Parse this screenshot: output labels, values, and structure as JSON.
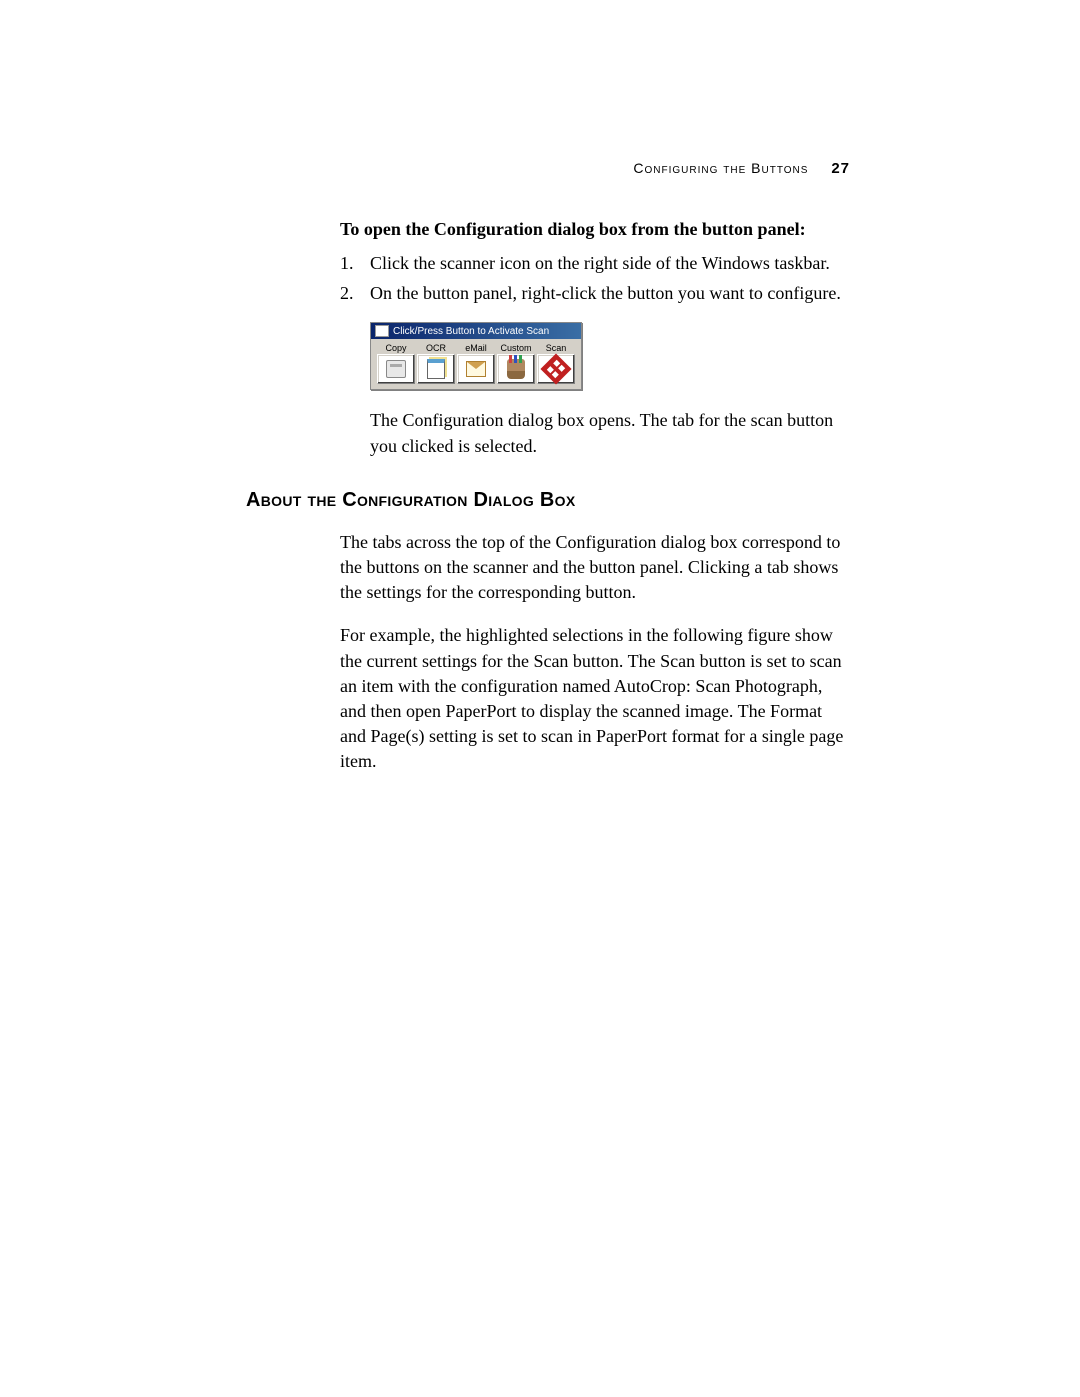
{
  "header": {
    "section": "Configuring the Buttons",
    "page_number": "27"
  },
  "intro_heading": "To open the Configuration dialog box from the button panel:",
  "steps": [
    "Click the scanner icon on the right side of the Windows taskbar.",
    "On the button panel, right-click the button you want to configure."
  ],
  "panel": {
    "title": "Click/Press Button to Activate Scan",
    "buttons": [
      {
        "label": "Copy",
        "icon": "icon-copy"
      },
      {
        "label": "OCR",
        "icon": "icon-ocr"
      },
      {
        "label": "eMail",
        "icon": "icon-email"
      },
      {
        "label": "Custom",
        "icon": "icon-custom"
      },
      {
        "label": "Scan",
        "icon": "icon-scan"
      }
    ]
  },
  "after_figure": "The Configuration dialog box opens. The tab for the scan button you clicked is selected.",
  "section_heading": "About the Configuration Dialog Box",
  "paragraphs": [
    "The tabs across the top of the Configuration dialog box correspond to the buttons on the scanner and the button panel. Clicking a tab shows the settings for the corresponding button.",
    "For example, the highlighted selections in the following figure show the current settings for the Scan button. The Scan button is set to scan an item with the configuration named AutoCrop: Scan Photograph, and then open PaperPort to display the scanned image. The Format and Page(s) setting is set to scan in PaperPort format for a single page item."
  ]
}
